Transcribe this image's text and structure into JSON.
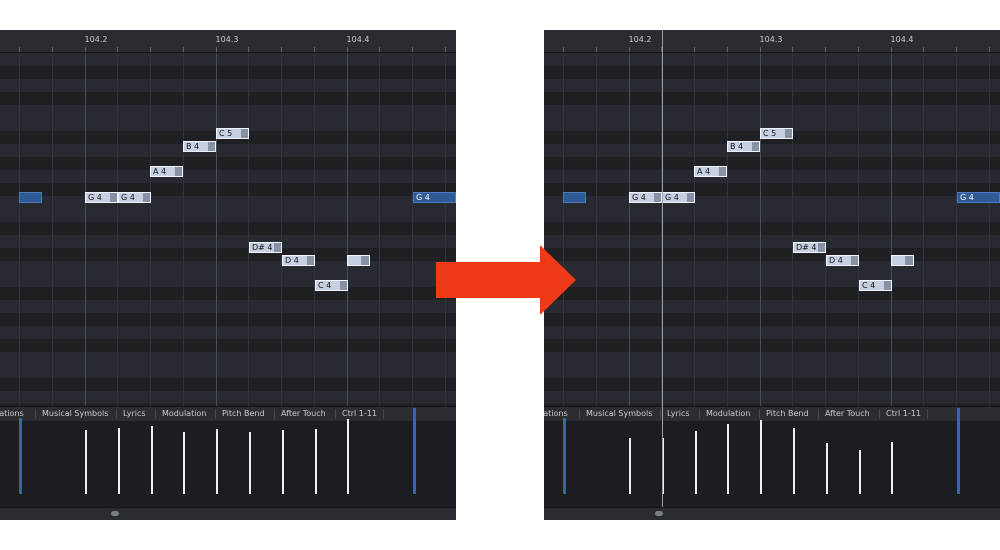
{
  "ruler_labels": [
    "104.2",
    "104.3",
    "104.4"
  ],
  "tabs": [
    "iations",
    "Musical Symbols",
    "Lyrics",
    "Modulation",
    "Pitch Bend",
    "After Touch",
    "Ctrl 1-11"
  ],
  "colors": {
    "arrow": "#ee3a16",
    "note": "#c7d0e2",
    "selected_note": "#2f5a95",
    "background": "#1f2126"
  },
  "before": {
    "notes": [
      {
        "label": "C 5"
      },
      {
        "label": "B 4"
      },
      {
        "label": "A 4"
      },
      {
        "label": ""
      },
      {
        "label": "G 4"
      },
      {
        "label": "G 4"
      },
      {
        "label": "G 4"
      },
      {
        "label": "D# 4"
      },
      {
        "label": "D 4"
      },
      {
        "label": ""
      },
      {
        "label": "C 4"
      }
    ]
  },
  "after": {
    "notes": [
      {
        "label": "C 5"
      },
      {
        "label": "B 4"
      },
      {
        "label": "A 4"
      },
      {
        "label": ""
      },
      {
        "label": "G 4"
      },
      {
        "label": "G 4"
      },
      {
        "label": "G 4"
      },
      {
        "label": "D# 4"
      },
      {
        "label": "D 4"
      },
      {
        "label": ""
      },
      {
        "label": "C 4"
      }
    ]
  }
}
